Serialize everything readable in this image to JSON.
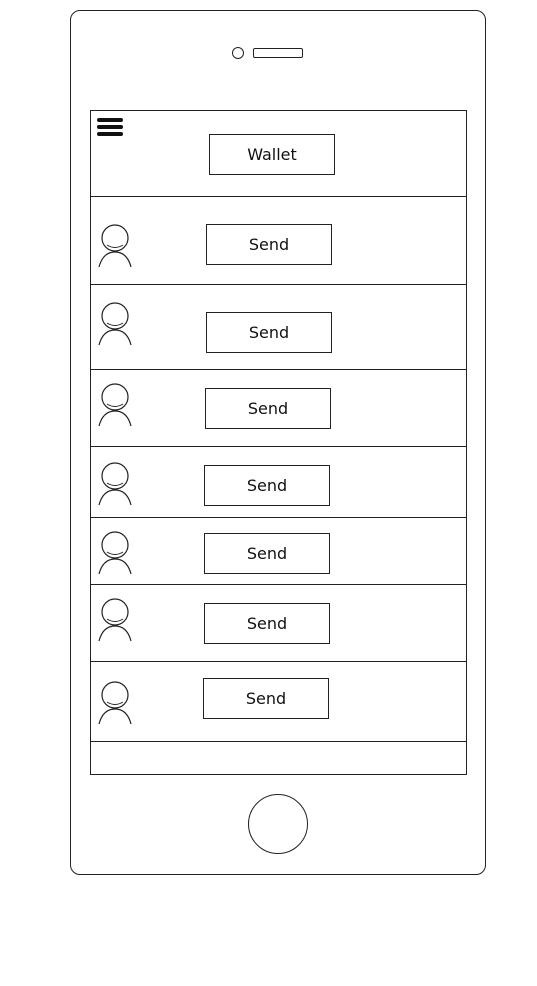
{
  "header": {
    "menu_icon": "hamburger-menu-icon",
    "wallet_label": "Wallet"
  },
  "contacts": [
    {
      "avatar_icon": "user-avatar-icon",
      "send_label": "Send"
    },
    {
      "avatar_icon": "user-avatar-icon",
      "send_label": "Send"
    },
    {
      "avatar_icon": "user-avatar-icon",
      "send_label": "Send"
    },
    {
      "avatar_icon": "user-avatar-icon",
      "send_label": "Send"
    },
    {
      "avatar_icon": "user-avatar-icon",
      "send_label": "Send"
    },
    {
      "avatar_icon": "user-avatar-icon",
      "send_label": "Send"
    },
    {
      "avatar_icon": "user-avatar-icon",
      "send_label": "Send"
    }
  ],
  "colors": {
    "stroke": "#222222",
    "background": "#ffffff"
  }
}
